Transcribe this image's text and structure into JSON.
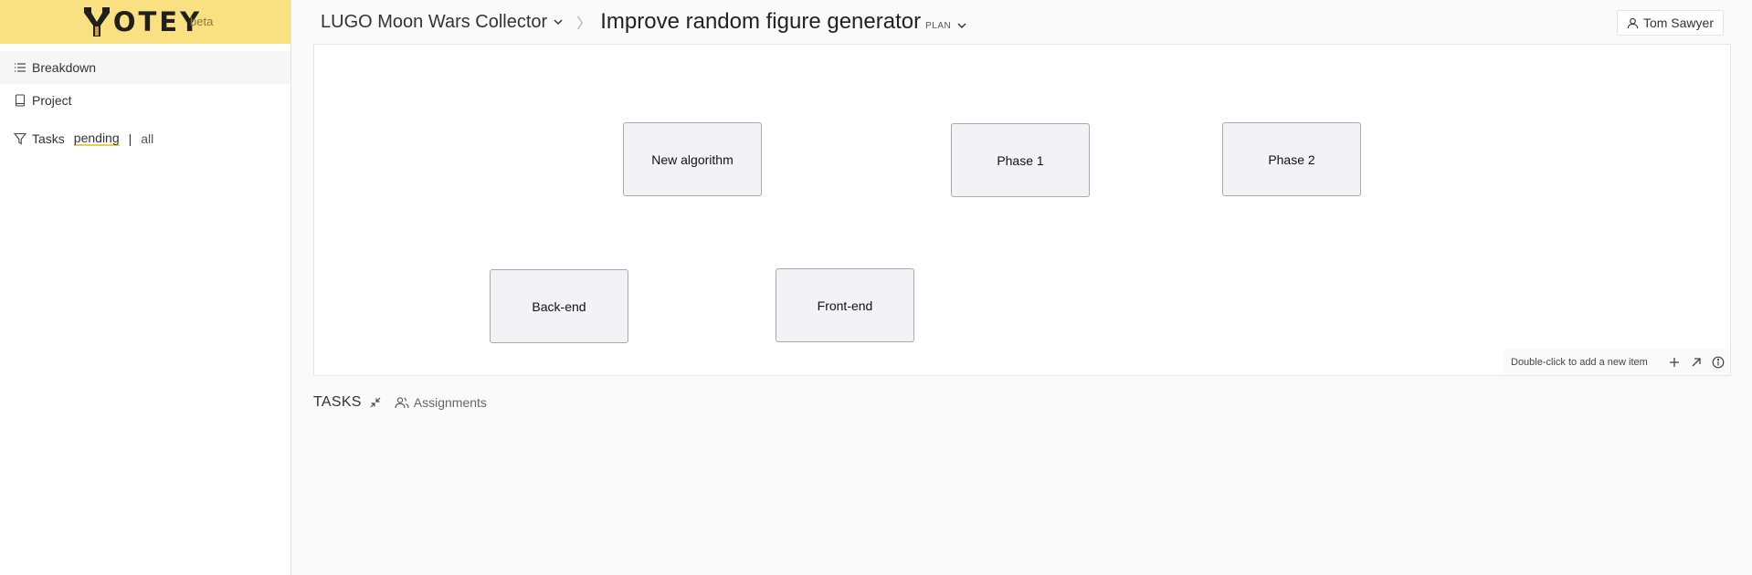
{
  "app": {
    "logo_text": "OTEY",
    "logo_letter": "Y",
    "beta_label": "beta"
  },
  "sidebar": {
    "items": [
      {
        "label": "Breakdown",
        "icon": "list-icon"
      },
      {
        "label": "Project",
        "icon": "book-icon"
      }
    ],
    "tasks_filter": {
      "label": "Tasks",
      "options": [
        "pending",
        "all"
      ],
      "separator": "|",
      "selected": "pending"
    }
  },
  "header": {
    "project_name": "LUGO Moon Wars Collector",
    "breadcrumb_separator": "〉",
    "plan_name": "Improve random figure generator",
    "plan_tag": "PLAN",
    "user_name": "Tom Sawyer"
  },
  "canvas": {
    "nodes": [
      {
        "label": "New algorithm"
      },
      {
        "label": "Phase 1"
      },
      {
        "label": "Phase 2"
      },
      {
        "label": "Back-end"
      },
      {
        "label": "Front-end"
      }
    ],
    "hint": "Double-click to add a new item"
  },
  "tasks": {
    "title": "TASKS",
    "assignments_label": "Assignments"
  },
  "colors": {
    "logo_bar": "#f9e181",
    "node_bg": "#f3f2f7",
    "node_border": "#aaaaaa",
    "filter_underline": "#f2c94c"
  }
}
